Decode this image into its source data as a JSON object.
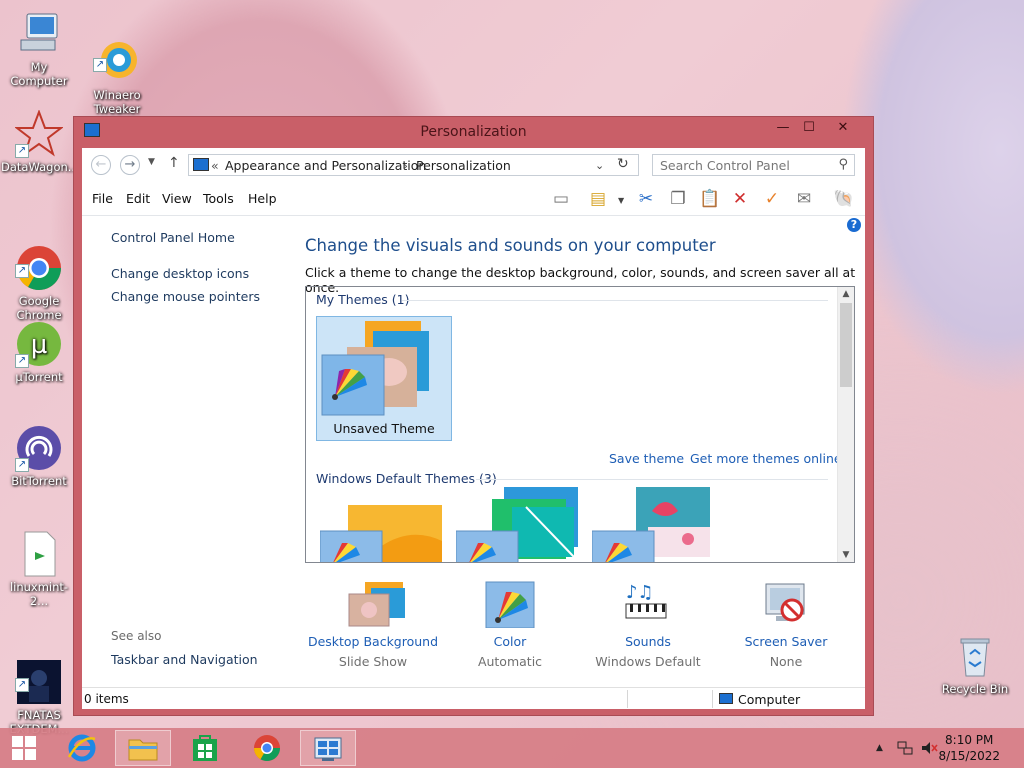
{
  "desktop": {
    "icons": [
      {
        "label": "My Computer",
        "icon": "computer-icon"
      },
      {
        "label": "Winaero\nTweaker",
        "icon": "winaero-icon"
      },
      {
        "label": "DataWagon...",
        "icon": "datawagon-icon"
      },
      {
        "label": "Google\nChrome",
        "icon": "chrome-icon"
      },
      {
        "label": "µTorrent",
        "icon": "utorrent-icon"
      },
      {
        "label": "BitTorrent",
        "icon": "bittorrent-icon"
      },
      {
        "label": "linuxmint-2...",
        "icon": "file-icon"
      },
      {
        "label": "FNATAS\nEXTDEM...",
        "icon": "fnatas-icon"
      },
      {
        "label": "Recycle Bin",
        "icon": "recycle-bin-icon"
      }
    ]
  },
  "window": {
    "title": "Personalization",
    "minimize": "—",
    "maximize": "☐",
    "close": "✕",
    "address": {
      "overflow": "«",
      "crumbs": [
        "Appearance and Personalization",
        "Personalization"
      ],
      "separator": "›"
    },
    "search_placeholder": "Search Control Panel",
    "menu": [
      "File",
      "Edit",
      "View",
      "Tools",
      "Help"
    ],
    "left_pane": {
      "links": [
        "Control Panel Home",
        "Change desktop icons",
        "Change mouse pointers"
      ],
      "see_also_label": "See also",
      "see_also_links": [
        "Taskbar and Navigation"
      ]
    },
    "main": {
      "title": "Change the visuals and sounds on your computer",
      "subtitle": "Click a theme to change the desktop background, color, sounds, and screen saver all at once.",
      "my_themes_header": "My Themes (1)",
      "my_themes": [
        {
          "label": "Unsaved Theme",
          "selected": true
        }
      ],
      "save_theme": "Save theme",
      "get_more": "Get more themes online",
      "default_header": "Windows Default Themes (3)"
    },
    "bottom": [
      {
        "title": "Desktop Background",
        "value": "Slide Show",
        "icon": "desktop-background-icon"
      },
      {
        "title": "Color",
        "value": "Automatic",
        "icon": "color-icon"
      },
      {
        "title": "Sounds",
        "value": "Windows Default",
        "icon": "sounds-icon"
      },
      {
        "title": "Screen Saver",
        "value": "None",
        "icon": "screen-saver-icon"
      }
    ],
    "status": {
      "items": "0 items",
      "location": "Computer"
    }
  },
  "taskbar": {
    "time": "8:10 PM",
    "date": "8/15/2022"
  }
}
